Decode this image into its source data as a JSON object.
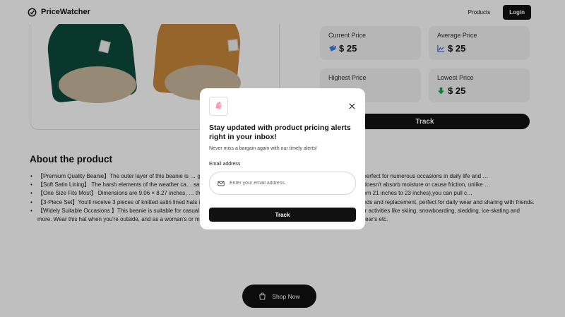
{
  "navbar": {
    "brand": "PriceWatcher",
    "products_link": "Products",
    "login_label": "Login"
  },
  "price_cards": [
    {
      "label": "Current Price",
      "value": "$ 25",
      "icon": "price-tag-icon",
      "color": "#3b82f6"
    },
    {
      "label": "Average Price",
      "value": "$ 25",
      "icon": "chart-icon",
      "color": "#6366f1"
    },
    {
      "label": "Highest Price",
      "value": "",
      "icon": "arrow-up-icon",
      "color": "#ef4444"
    },
    {
      "label": "Lowest Price",
      "value": "$ 25",
      "icon": "arrow-down-icon",
      "color": "#16a34a"
    }
  ],
  "track_main_label": "Track",
  "about": {
    "title": "About the product",
    "items": [
      "【Premium Quality Beanie】The outer layer of this beanie is … golden polyester satin. Soft to touch and irresistible to remove, it's perfect for numerous occasions in daily life and …",
      "【Soft Satin Lining】 The harsh elements of the weather ca… satin lining to protect your tresses! Satin is perfect for hair care as it doesn't absorb moisture or cause friction, unlike …",
      "【One Size Fits Most】 Dimensions are 9.06 × 8.27 inches, … th and fits comfortably for men and women (head circumferences from 21 inches to 23 inches),you can pull c…",
      "【3-Piece Set】You'll receive 3 pieces of knitted satin lined hats in 3 colors, The classic colors and quantity can meet your daily needs and replacement, perfect for daily wear and sharing with friends.",
      "【Widely Suitable Occasions 】This beanie is suitable for casual wear in daily life and for outdoor sports activities. Perfect for winter activities like skiing, snowboarding, sledding, ice-skating and more. Wear this hat when you're outside, and as a woman's or man's gift for birthdays, Halloween, Thanksgiving, Christmas, New Year's etc."
    ]
  },
  "shop_now_label": "Shop Now",
  "modal": {
    "title": "Stay updated with product pricing alerts right in your inbox!",
    "subtitle": "Never miss a bargain again with our timely alerts!",
    "email_label": "Email address",
    "email_placeholder": "Enter your email address",
    "email_value": "",
    "track_label": "Track"
  }
}
